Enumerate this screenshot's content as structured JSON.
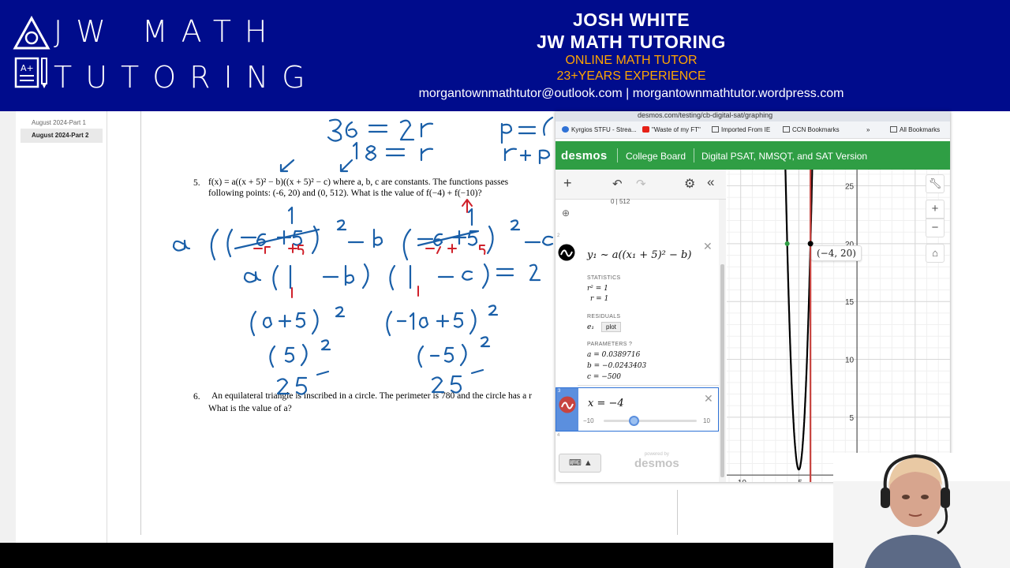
{
  "banner": {
    "logo_line1": "JW MATH",
    "logo_line2": "TUTORING",
    "name": "JOSH WHITE",
    "company": "JW MATH TUTORING",
    "tagline1": "ONLINE MATH TUTOR",
    "tagline2": "23+YEARS EXPERIENCE",
    "contact": "morgantownmathtutor@outlook.com | morgantownmathtutor.wordpress.com",
    "icons": [
      "triangle-logo-icon",
      "document-pencil-icon"
    ],
    "colors": {
      "background": "#000c8c",
      "accent": "#ffa500",
      "text": "#ffffff"
    }
  },
  "document": {
    "pages": [
      "August 2024-Part 1",
      "August 2024-Part 2"
    ],
    "selected_page": "August 2024-Part 2",
    "q5": {
      "number": "5.",
      "line1": "f(x) = a((x + 5)² − b)((x + 5)² − c) where a, b, c are constants.  The functions passes",
      "line2": "following points: (-6, 20) and (0, 512).  What is the value of f(−4) + f(−10)?"
    },
    "q6": {
      "number": "6.",
      "line1": "An equilateral triangle is inscribed in a circle.  The perimeter is 780 and the circle has a r",
      "line2": "What is the value of a?"
    }
  },
  "desmos": {
    "url": "desmos.com/testing/cb-digital-sat/graphing",
    "bookmarks": [
      "Kyrgios STFU - Strea...",
      "\"Waste of my FT\"",
      "Imported From IE",
      "CCN Bookmarks",
      "»",
      "All Bookmarks"
    ],
    "header": {
      "logo": "desmos",
      "college_board": "College Board",
      "version": "Digital PSAT, NMSQT, and SAT Version",
      "color": "#2f9e44"
    },
    "toolbar": {
      "add": "+",
      "undo": "↶",
      "redo": "↷",
      "settings": "⚙",
      "collapse": "«"
    },
    "table_fragment": "0   |   512",
    "expressions": [
      {
        "index": "2",
        "formula": "y₁ ~ a((x₁ + 5)² − b)",
        "statistics_label": "STATISTICS",
        "r2": "r² = 1",
        "r": "r = 1",
        "residuals_label": "RESIDUALS",
        "residual_var": "e₁",
        "residual_button": "plot",
        "parameters_label": "PARAMETERS ?",
        "a": "a = 0.0389716",
        "b": "b = −0.0243403",
        "c": "c = −500"
      },
      {
        "index": "3",
        "formula": "x = −4",
        "slider_min": "−10",
        "slider_max": "10",
        "slider_value": -4
      }
    ],
    "next_index": "4",
    "keyboard": "⌨ ▲",
    "powered_small": "powered by",
    "powered_big": "desmos",
    "graph": {
      "y_ticks": [
        "25",
        "20",
        "15",
        "10",
        "5",
        "0"
      ],
      "x_ticks": [
        "-10",
        "-5",
        "0"
      ],
      "point_label": "(−4, 20)",
      "controls": [
        "wrench-icon",
        "zoom-in",
        "zoom-out",
        "home-icon"
      ],
      "curve_color": "#000000",
      "line_color": "#c74440"
    }
  }
}
